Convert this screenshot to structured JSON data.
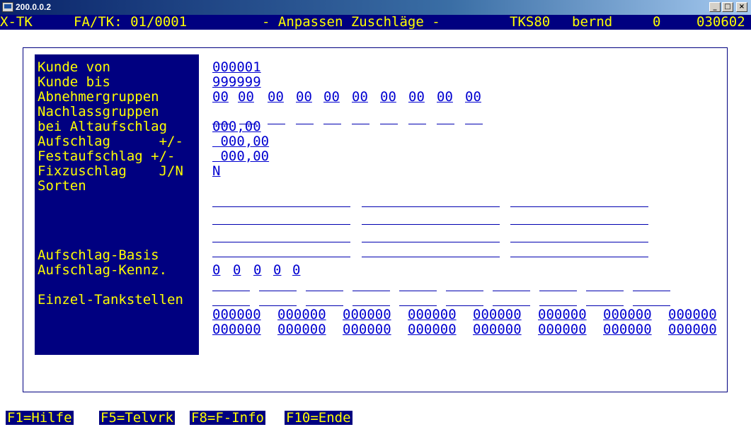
{
  "window": {
    "title": "200.0.0.2",
    "buttons": {
      "minimize": "_",
      "maximize": "□",
      "close": "×"
    }
  },
  "header": {
    "app": "X-TK",
    "firm": "FA/TK: 01/0001",
    "function": "- Anpassen Zuschläge -",
    "system": "TKS80",
    "user": "bernd",
    "session": "0",
    "date": "030602"
  },
  "form": {
    "labels": {
      "kunde_von": "Kunde von",
      "kunde_bis": "Kunde bis",
      "abnehmergruppen": "Abnehmergruppen",
      "nachlassgruppen": "Nachlassgruppen",
      "bei_altaufschlag": "bei Altaufschlag",
      "aufschlag": "Aufschlag      +/-",
      "festaufschlag": "Festaufschlag +/-",
      "fixzuschlag": "Fixzuschlag    J/N",
      "sorten": "Sorten",
      "aufschlag_basis": "Aufschlag-Basis",
      "aufschlag_kennz": "Aufschlag-Kennz.",
      "einzel_tankstellen": "Einzel-Tankstellen"
    },
    "values": {
      "kunde_von": "000001",
      "kunde_bis": "999999",
      "abnehmergruppen": [
        "00",
        "00",
        "00",
        "00",
        "00",
        "00",
        "00",
        "00",
        "00",
        "00"
      ],
      "bei_altaufschlag": "000,00",
      "aufschlag": " 000,00",
      "festaufschlag": " 000,00",
      "fixzuschlag": "N",
      "aufschlag_basis": [
        "0",
        "0",
        "0",
        "0",
        "0"
      ],
      "einzel_tankstellen": [
        [
          "000000",
          "000000",
          "000000",
          "000000",
          "000000",
          "000000",
          "000000",
          "000000"
        ],
        [
          "000000",
          "000000",
          "000000",
          "000000",
          "000000",
          "000000",
          "000000",
          "000000"
        ]
      ]
    }
  },
  "function_keys": [
    "F1=Hilfe",
    "F5=Telvrk",
    "F8=F-Info",
    "F10=Ende"
  ],
  "colors": {
    "background": "#ffffff",
    "panel": "#000080",
    "label_text": "#ffff00",
    "field_text": "#0000d0"
  }
}
